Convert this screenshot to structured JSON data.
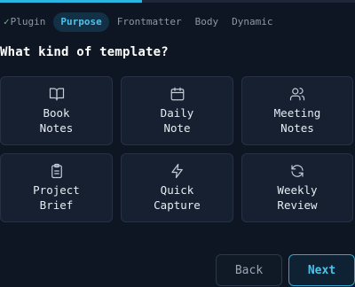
{
  "progress": {
    "fraction": 0.4
  },
  "steps": [
    {
      "check": "✓",
      "label": "Plugin",
      "state": "done"
    },
    {
      "label": "Purpose",
      "state": "active"
    },
    {
      "label": "Frontmatter",
      "state": "pending"
    },
    {
      "label": "Body",
      "state": "pending"
    },
    {
      "label": "Dynamic",
      "state": "pending"
    }
  ],
  "question": "What kind of template?",
  "templates": [
    {
      "icon": "open-book-icon",
      "line1": "Book",
      "line2": "Notes"
    },
    {
      "icon": "calendar-icon",
      "line1": "Daily",
      "line2": "Note"
    },
    {
      "icon": "users-icon",
      "line1": "Meeting",
      "line2": "Notes"
    },
    {
      "icon": "clipboard-icon",
      "line1": "Project",
      "line2": "Brief"
    },
    {
      "icon": "lightning-icon",
      "line1": "Quick",
      "line2": "Capture"
    },
    {
      "icon": "refresh-icon",
      "line1": "Weekly",
      "line2": "Review"
    }
  ],
  "buttons": {
    "back": "Back",
    "next": "Next"
  },
  "colors": {
    "accent": "#29b6e0",
    "background": "#0f1623",
    "card": "#162030",
    "done_check": "#5fbf8a"
  }
}
